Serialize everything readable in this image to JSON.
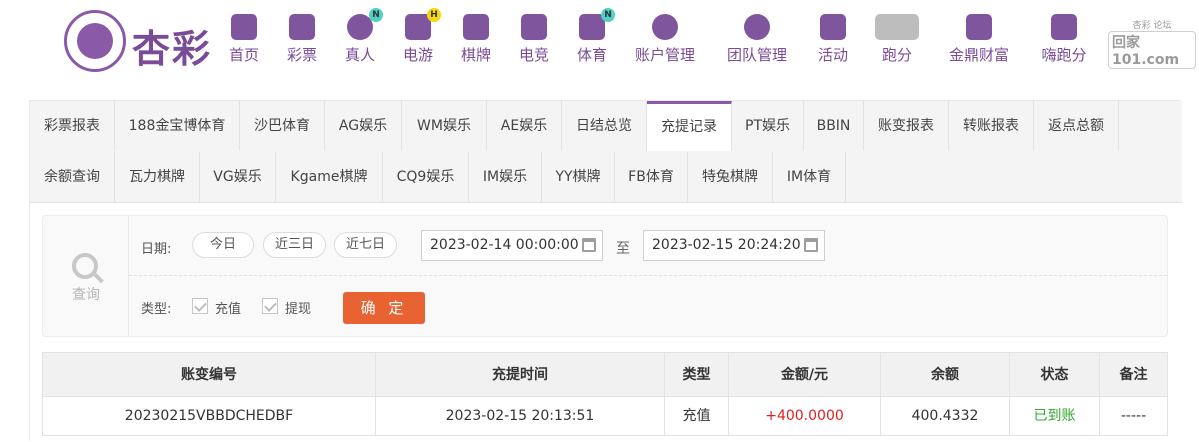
{
  "header": {
    "logo_text": "杏彩",
    "nav": [
      {
        "label": "首页",
        "icon": "home-icon"
      },
      {
        "label": "彩票",
        "icon": "lottery-ticket-icon"
      },
      {
        "label": "真人",
        "icon": "live-dealer-icon",
        "badge": "N"
      },
      {
        "label": "电游",
        "icon": "gamepad-icon",
        "badge": "H"
      },
      {
        "label": "棋牌",
        "icon": "cards-icon"
      },
      {
        "label": "电竞",
        "icon": "esports-controller-icon"
      },
      {
        "label": "体育",
        "icon": "trophy-icon",
        "badge": "N"
      },
      {
        "label": "账户管理",
        "icon": "account-coin-icon"
      },
      {
        "label": "团队管理",
        "icon": "team-icon"
      },
      {
        "label": "活动",
        "icon": "gift-icon"
      },
      {
        "label": "跑分",
        "icon": "car-icon"
      },
      {
        "label": "金鼎财富",
        "icon": "treasure-icon"
      },
      {
        "label": "嗨跑分",
        "icon": "hi-app-icon"
      }
    ],
    "watermark": {
      "top_left": "杏彩",
      "top_right": "论坛",
      "main": "回家101.com"
    }
  },
  "tabs_row1": [
    "彩票报表",
    "188金宝博体育",
    "沙巴体育",
    "AG娱乐",
    "WM娱乐",
    "AE娱乐",
    "日结总览",
    "充提记录",
    "PT娱乐",
    "BBIN",
    "账变报表",
    "转账报表",
    "返点总额"
  ],
  "tabs_row2": [
    "余额查询",
    "瓦力棋牌",
    "VG娱乐",
    "Kgame棋牌",
    "CQ9娱乐",
    "IM娱乐",
    "YY棋牌",
    "FB体育",
    "特兔棋牌",
    "IM体育"
  ],
  "active_tab": "充提记录",
  "filter": {
    "query_label": "查询",
    "date_label": "日期:",
    "quick_dates": [
      "今日",
      "近三日",
      "近七日"
    ],
    "start_datetime": "2023-02-14 00:00:00",
    "to_label": "至",
    "end_datetime": "2023-02-15 20:24:20",
    "type_label": "类型:",
    "types": [
      "充值",
      "提现"
    ],
    "confirm_label": "确 定"
  },
  "table": {
    "headers": [
      "账变编号",
      "充提时间",
      "类型",
      "金额/元",
      "余额",
      "状态",
      "备注"
    ],
    "rows": [
      [
        "20230215VBBDCHEDBF",
        "2023-02-15 20:13:51",
        "充值",
        "+400.0000",
        "400.4332",
        "已到账",
        "-----"
      ]
    ]
  },
  "colors": {
    "brand": "#7a4b96",
    "confirm": "#e86331",
    "amount": "#e02020",
    "status_ok": "#2fa82f"
  }
}
